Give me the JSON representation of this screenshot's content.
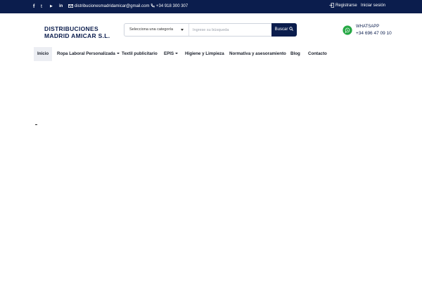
{
  "topbar": {
    "social": [
      {
        "icon": "facebook-icon",
        "glyph": "f"
      },
      {
        "icon": "twitter-icon",
        "glyph": "t"
      },
      {
        "icon": "youtube-icon",
        "glyph": "▶"
      },
      {
        "icon": "linkedin-icon",
        "glyph": "in"
      }
    ],
    "email": "distribucionesmadridamicar@gmail.com",
    "phone": "+34 918 300 307",
    "register": "Registrarse",
    "login": "Iniciar sesión"
  },
  "brand": {
    "line1": "DISTRIBUCIONES",
    "line2": "MADRID AMICAR S.L."
  },
  "search": {
    "category": "Selecciona una categoría",
    "placeholder": "Ingrese su búsqueda",
    "button": "Buscar"
  },
  "whatsapp": {
    "label": "WHATSAPP",
    "phone": "+34 696 47 09 10"
  },
  "nav": [
    {
      "label": "Inicio",
      "active": true
    },
    {
      "label": "Ropa Laboral Personalizada",
      "dropdown": true
    },
    {
      "label": "Textil publicitario"
    },
    {
      "label": "EPIS",
      "dropdown": true
    },
    {
      "label": "Higiene y Limpieza"
    },
    {
      "label": "Normativa y asesoramiento"
    },
    {
      "label": "Blog"
    },
    {
      "label": "Contacto"
    }
  ],
  "colors": {
    "primary": "#0b1d4d",
    "whatsapp": "#25a844"
  }
}
